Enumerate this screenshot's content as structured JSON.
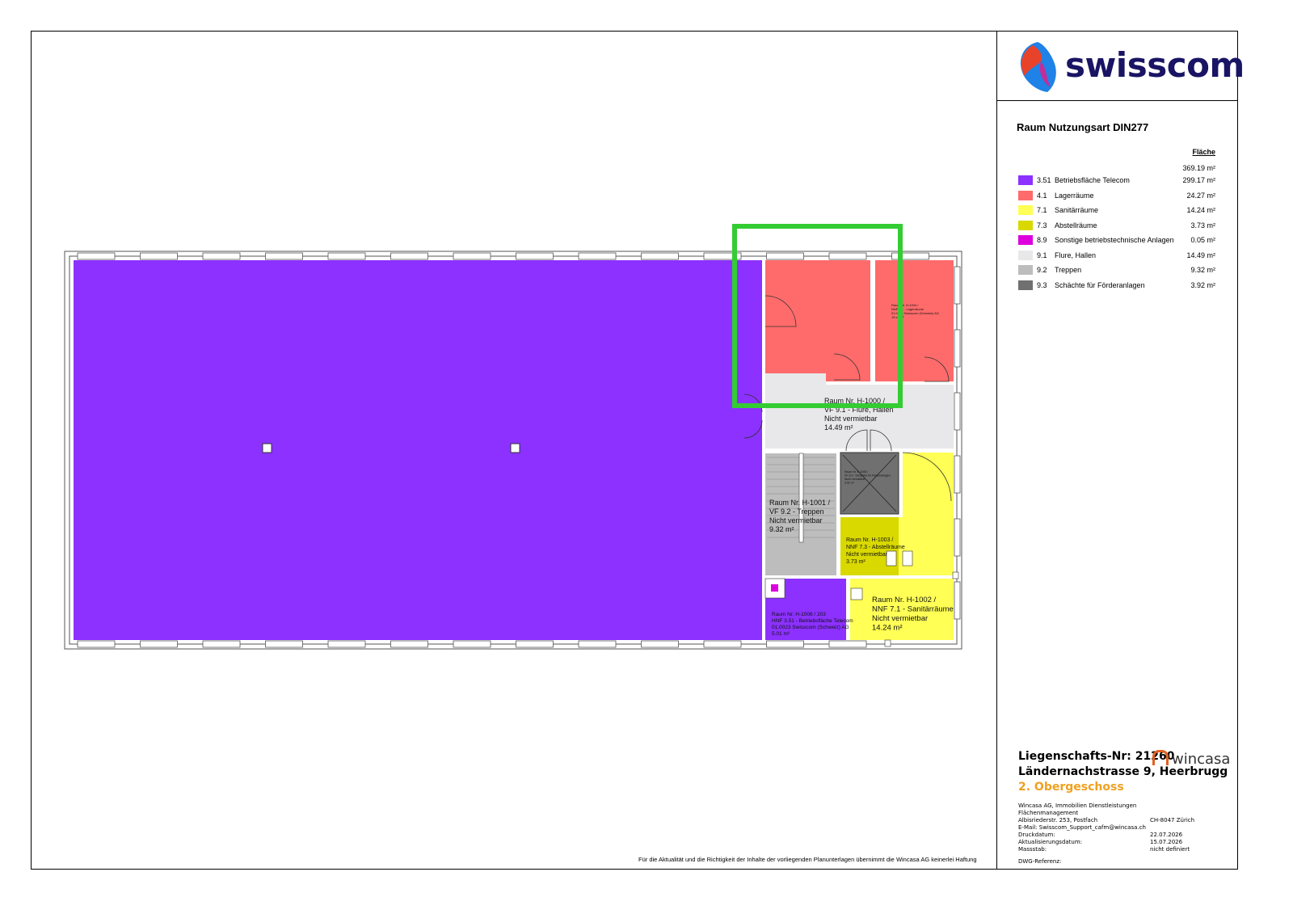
{
  "header": {
    "brand": "swisscom"
  },
  "legend": {
    "title": "Raum Nutzungsart DIN277",
    "column_header": "Fläche",
    "total": "369.19 m²",
    "items": [
      {
        "code": "3.51",
        "label": "Betriebsfläche Telecom",
        "area": "299.17 m²",
        "color": "#8c31ff"
      },
      {
        "code": "4.1",
        "label": "Lagerräume",
        "area": "24.27 m²",
        "color": "#ff6b6b"
      },
      {
        "code": "7.1",
        "label": "Sanitärräume",
        "area": "14.24 m²",
        "color": "#ffff55"
      },
      {
        "code": "7.3",
        "label": "Abstellräume",
        "area": "3.73 m²",
        "color": "#d9d900"
      },
      {
        "code": "8.9",
        "label": "Sonstige betriebstechnische Anlagen",
        "area": "0.05 m²",
        "color": "#dd00dd"
      },
      {
        "code": "9.1",
        "label": "Flure, Hallen",
        "area": "14.49 m²",
        "color": "#e8e8ea"
      },
      {
        "code": "9.2",
        "label": "Treppen",
        "area": "9.32 m²",
        "color": "#bdbdbd"
      },
      {
        "code": "9.3",
        "label": "Schächte für Förderanlagen",
        "area": "3.92 m²",
        "color": "#707070"
      }
    ]
  },
  "rooms": {
    "h1000": [
      "Raum Nr. H-1000 /",
      "VF 9.1 - Flure, Hallen",
      "Nicht vermietbar",
      "14.49 m²"
    ],
    "h1001": [
      "Raum Nr. H-1001 /",
      "VF 9.2 - Treppen",
      "Nicht vermietbar",
      "9.32 m²"
    ],
    "h1002": [
      "Raum Nr. H-1002 /",
      "NNF 7.1 - Sanitärräume",
      "Nicht vermietbar",
      "14.24 m²"
    ],
    "h1003": [
      "Raum Nr. H-1003 /",
      "NNF 7.3 - Abstellräume",
      "Nicht vermietbar",
      "3.73 m²"
    ],
    "h1004": [
      "Raum Nr. H-1004 /",
      "NNF 4.1 - Lagerräume",
      "01.0023 Swisscom (Schweiz) AG",
      "15.xx m²"
    ],
    "h1005": [
      "Raum Nr. H-1005 /",
      "VF 9.3 - Schächte für Förderanlagen",
      "Nicht vermietbar",
      "3.92 m²"
    ],
    "h1006": [
      "Raum Nr. H-1006 / 203",
      "HNF 3.51 - Betriebsfläche Telecom",
      "01.0023 Swisscom (Schweiz) AG",
      "5.01 m²"
    ]
  },
  "property": {
    "number_label": "Liegenschafts-Nr:  21260",
    "address": "Ländernachstrasse 9, Heerbrugg",
    "floor": "2. Obergeschoss",
    "partner": "wincasa"
  },
  "info": {
    "company": "Wincasa AG, Immobilien Dienstleistungen",
    "dept": "Flächenmanagement",
    "street": "Albisriederstr. 253, Postfach",
    "city": "CH-8047 Zürich",
    "email": "E-Mail: Swisscom_Support_cafm@wincasa.ch",
    "print_label": "Druckdatum:",
    "print_date": "22.07.2026",
    "update_label": "Aktualisierungsdatum:",
    "update_date": "15.07.2026",
    "scale_label": "Massstab:",
    "scale_value": "nicht definiert",
    "dwg_label": "DWG-Referenz:"
  },
  "disclaimer": "Für die Aktualität und die Richtigkeit der Inhalte der vorliegenden Planunterlagen übernimmt die Wincasa AG keinerlei Haftung",
  "highlight_color": "#33cc33"
}
